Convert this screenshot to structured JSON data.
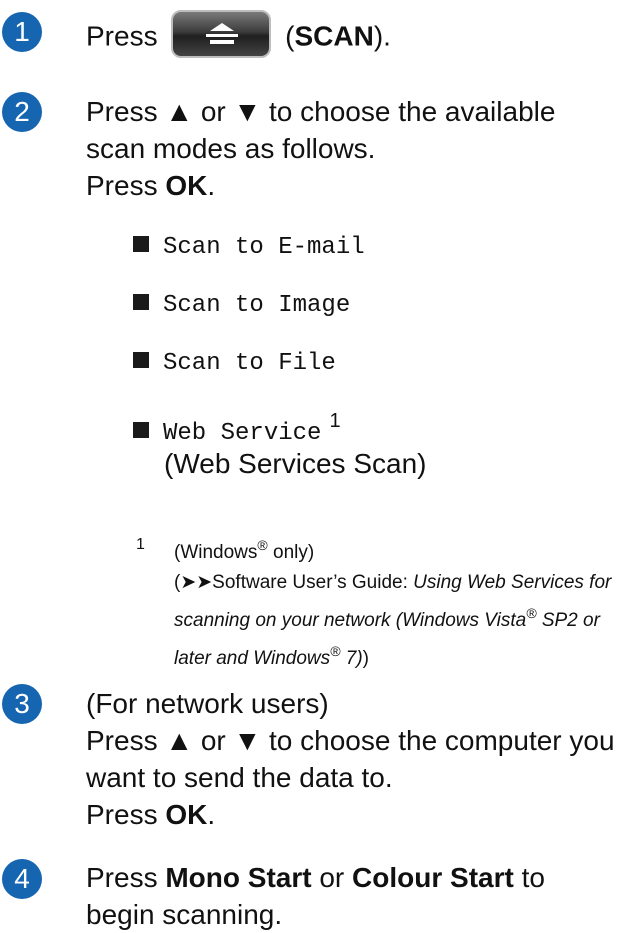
{
  "steps": [
    {
      "number": "1",
      "text_before": "Press",
      "button_icon": "scan-tray-icon",
      "text_after_open": "(",
      "bold": "SCAN",
      "text_after_close": ")."
    },
    {
      "number": "2",
      "line1": "Press ▲ or ▼ to choose the available",
      "line2": "scan modes as follows.",
      "press": "Press ",
      "ok": "OK",
      "period": "."
    },
    {
      "number": "3",
      "line1": "(For network users)",
      "line2": "Press ▲ or ▼ to choose the computer you",
      "line3": "want to send the data to.",
      "press": "Press ",
      "ok": "OK",
      "period": "."
    },
    {
      "number": "4",
      "press": "Press ",
      "mono": "Mono Start",
      "or": " or ",
      "colour": "Colour Start",
      "to": " to",
      "line2": "begin scanning."
    }
  ],
  "scan_modes": [
    {
      "label": "Scan to E-mail"
    },
    {
      "label": "Scan to Image"
    },
    {
      "label": "Scan to File"
    },
    {
      "label": "Web Service",
      "footnote_ref": "1",
      "sub": "(Web Services Scan)"
    }
  ],
  "footnote": {
    "number": "1",
    "windows": "(Windows",
    "reg": "®",
    "only": " only)",
    "ref_open": "(",
    "arrows": "➤➤",
    "guide": "Software User’s Guide: ",
    "italic1": "Using Web Services for scanning on your network (Windows Vista",
    "italic2": " SP2 or later and Windows",
    "italic3": " 7)",
    "close": ")"
  },
  "colors": {
    "step_badge": "#1565b0"
  }
}
